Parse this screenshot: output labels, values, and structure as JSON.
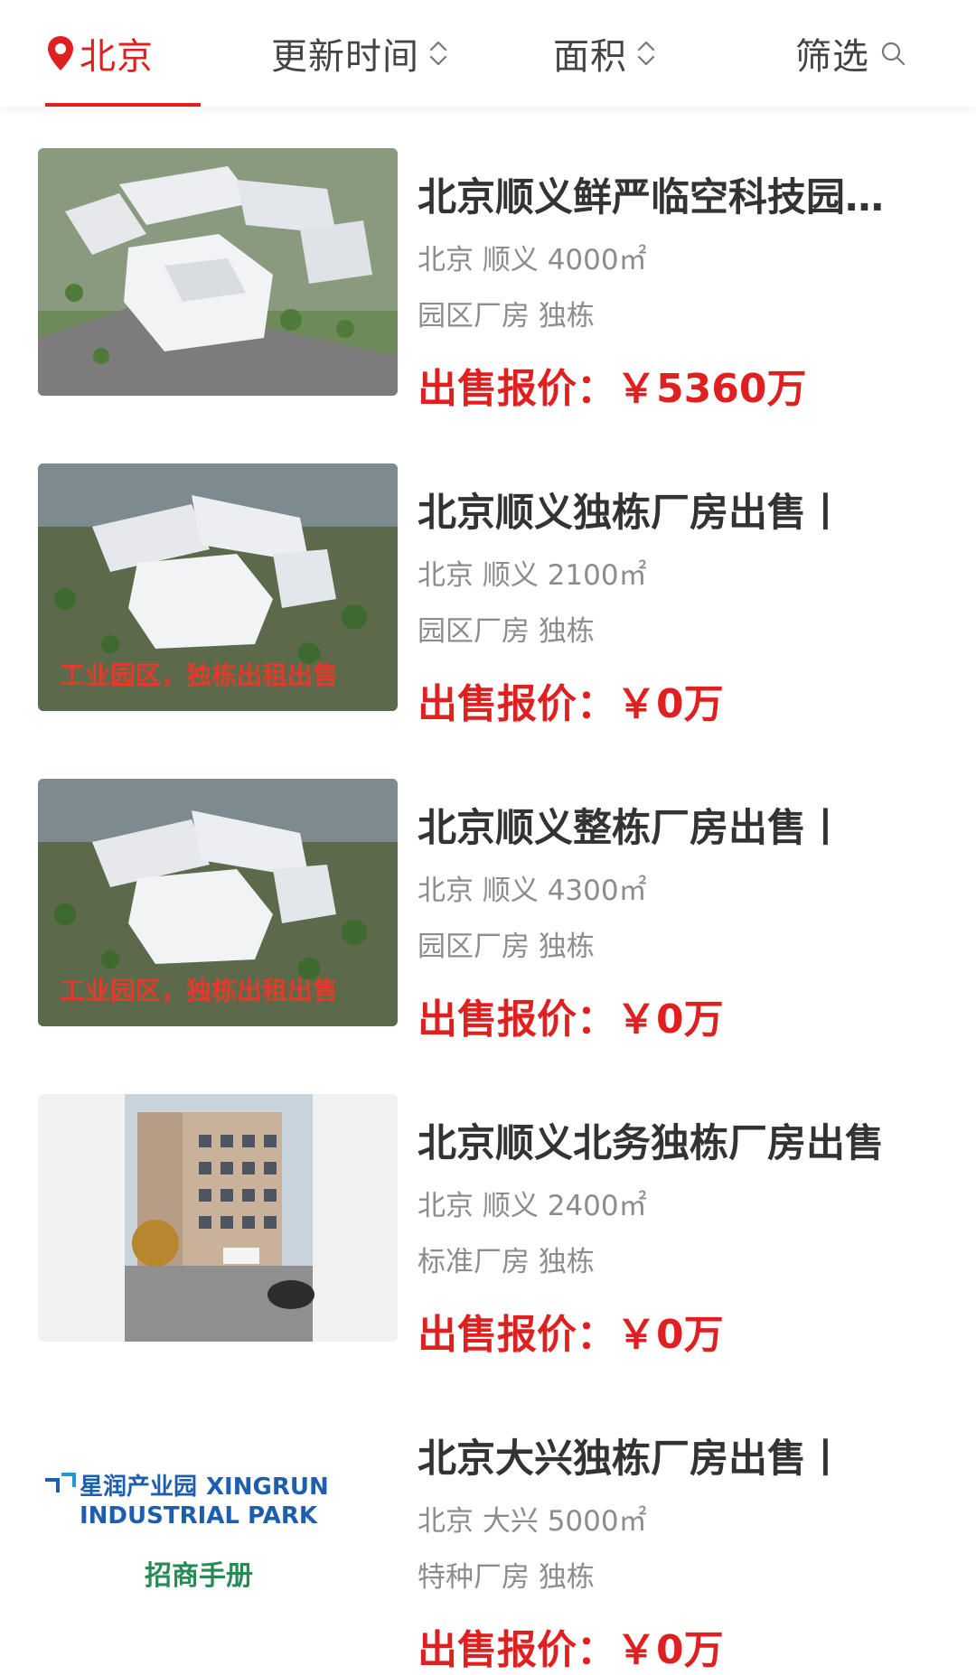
{
  "header": {
    "city_label": "北京",
    "sort_update_label": "更新时间",
    "sort_area_label": "面积",
    "filter_label": "筛选"
  },
  "listings": [
    {
      "title": "北京顺义鲜严临空科技园区独栋厂房出售",
      "location": "北京 顺义 4000㎡",
      "tags": "园区厂房 独栋",
      "price": "出售报价：￥5360万"
    },
    {
      "title": "北京顺义独栋厂房出售丨",
      "image_caption": "工业园区，独栋出租出售",
      "location": "北京 顺义 2100㎡",
      "tags": "园区厂房 独栋",
      "price": "出售报价：￥0万"
    },
    {
      "title": "北京顺义整栋厂房出售丨",
      "image_caption": "工业园区，独栋出租出售",
      "location": "北京 顺义 4300㎡",
      "tags": "园区厂房 独栋",
      "price": "出售报价：￥0万"
    },
    {
      "title": "北京顺义北务独栋厂房出售",
      "location": "北京 顺义 2400㎡",
      "tags": "标准厂房 独栋",
      "price": "出售报价：￥0万"
    },
    {
      "title": "北京大兴独栋厂房出售丨",
      "logo_cn": "星润产业园",
      "logo_en_1": "XINGRUN",
      "logo_en_2": "INDUSTRIAL PARK",
      "logo_sub": "招商手册",
      "location": "北京 大兴 5000㎡",
      "tags": "特种厂房 独栋",
      "price": "出售报价：￥0万"
    }
  ],
  "colors": {
    "accent": "#e02020",
    "title": "#333333",
    "meta": "#8c8c8c"
  },
  "icons": [
    "location-pin-icon",
    "sort-updown-icon",
    "search-icon"
  ]
}
